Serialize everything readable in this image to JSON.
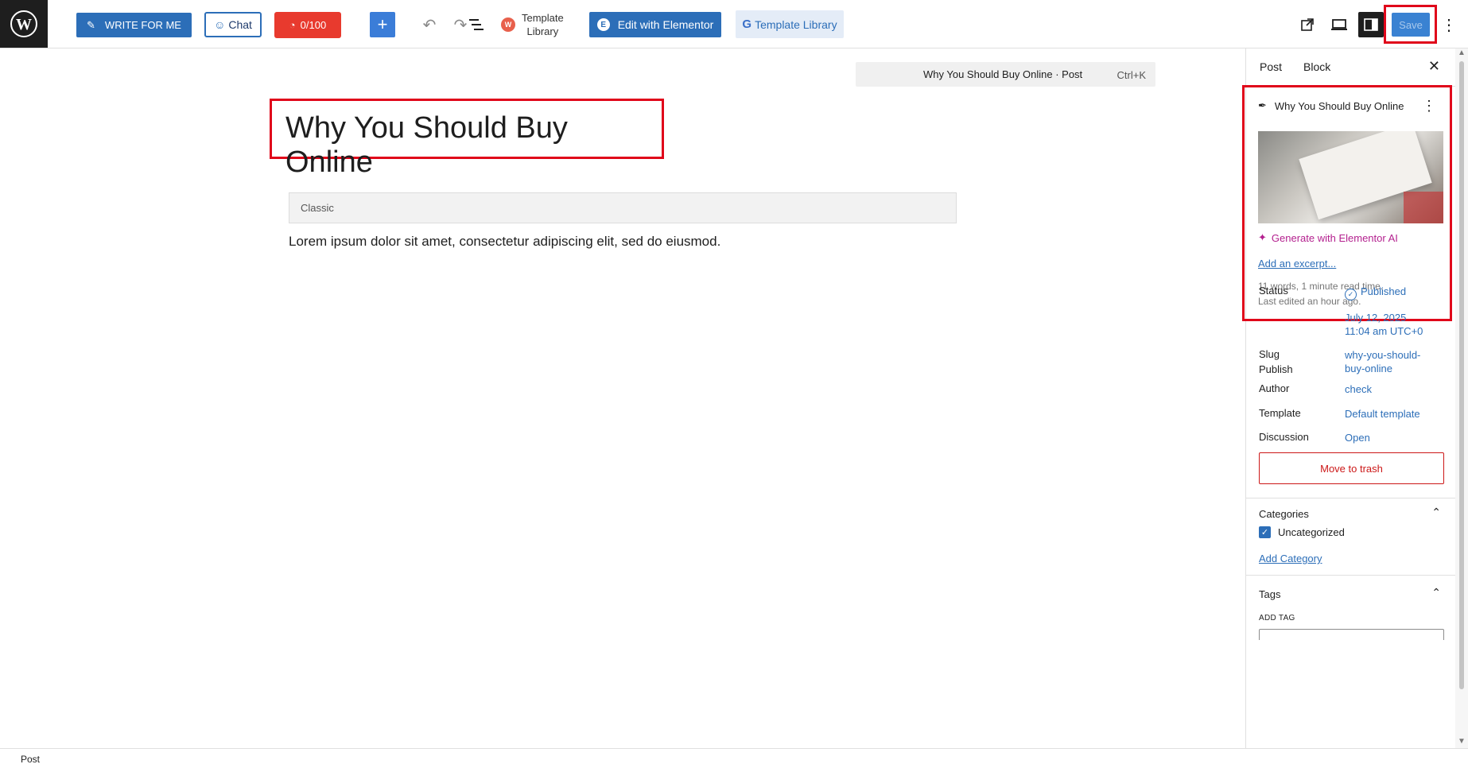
{
  "toolbar": {
    "write_label": "WRITE FOR ME",
    "chat_label": "Chat",
    "score_label": "0/100",
    "template_library_line1": "Template",
    "template_library_line2": "Library",
    "edit_elementor_label": "Edit with Elementor",
    "template_library_button": "Template Library",
    "save_label": "Save"
  },
  "command_bar": {
    "title": "Why You Should Buy Online · Post",
    "shortcut": "Ctrl+K"
  },
  "editor": {
    "post_title": "Why You Should Buy Online",
    "classic_label": "Classic",
    "body": "Lorem ipsum dolor sit amet, consectetur adipiscing elit, sed do eiusmod."
  },
  "sidebar": {
    "tabs": [
      "Post",
      "Block"
    ],
    "summary_title": "Why You Should Buy Online",
    "generate_ai": "Generate with Elementor AI",
    "add_excerpt": "Add an excerpt...",
    "word_count": "11 words, 1 minute read time.",
    "last_edited": "Last edited an hour ago.",
    "fields": [
      {
        "label": "Status",
        "value": "Published"
      },
      {
        "label": "Publish",
        "value": "July 12, 2025 11:04 am UTC+0"
      },
      {
        "label": "Slug",
        "value": "why-you-should-buy-online"
      },
      {
        "label": "Author",
        "value": "check"
      },
      {
        "label": "Template",
        "value": "Default template"
      },
      {
        "label": "Discussion",
        "value": "Open"
      }
    ],
    "trash_label": "Move to trash",
    "categories_heading": "Categories",
    "category_item": "Uncategorized",
    "add_category": "Add Category",
    "tags_heading": "Tags",
    "add_tag_label": "ADD TAG"
  },
  "footer": {
    "breadcrumb": "Post"
  },
  "colors": {
    "primary": "#2c6eb8",
    "danger": "#e83a2e",
    "highlight": "#e0061a",
    "ai": "#b4218f"
  }
}
